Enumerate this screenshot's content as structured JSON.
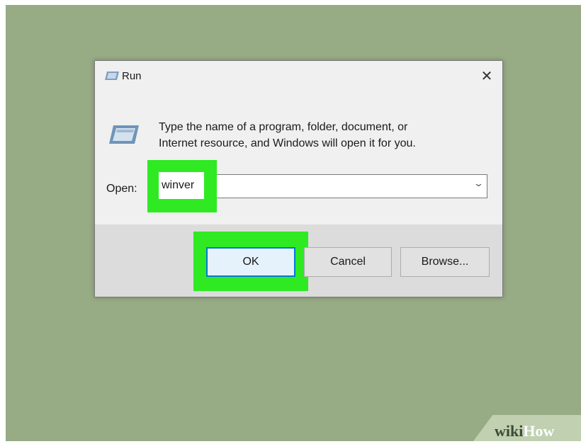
{
  "dialog": {
    "title": "Run",
    "close_glyph": "✕",
    "description_lines": [
      "Type the name of a program, folder, document, or",
      "Internet resource, and Windows will open it for you."
    ],
    "open_label": "Open:",
    "open_value": "winver",
    "combo_arrow": "⌄",
    "ok_label": "OK",
    "cancel_label": "Cancel",
    "browse_label": "Browse..."
  },
  "icons": {
    "title": "run-icon",
    "main": "run-program-icon",
    "close": "close-icon",
    "dropdown": "chevron-down-icon"
  },
  "colors": {
    "desktop": "#97ab85",
    "highlight": "#2fea22",
    "accent": "#0078d7"
  },
  "watermark": {
    "part1": "wiki",
    "part2": "How"
  }
}
